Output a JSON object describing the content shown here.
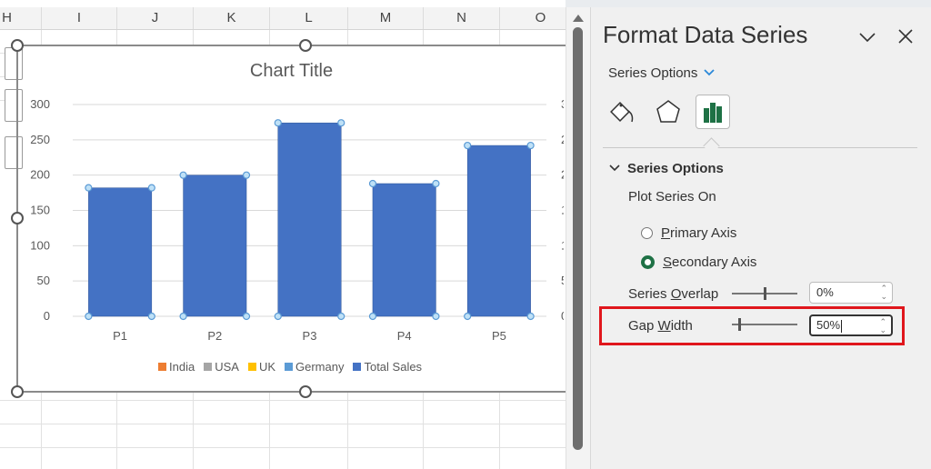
{
  "sheet": {
    "columns": [
      "H",
      "I",
      "J",
      "K",
      "L",
      "M",
      "N",
      "O"
    ]
  },
  "chart": {
    "title": "Chart Title"
  },
  "chart_data": {
    "type": "bar",
    "title": "Chart Title",
    "categories": [
      "P1",
      "P2",
      "P3",
      "P4",
      "P5"
    ],
    "series": [
      {
        "name": "Total Sales",
        "values": [
          182,
          200,
          274,
          188,
          242
        ],
        "color": "#4472c4",
        "axis": "secondary",
        "selected": true
      }
    ],
    "legend": [
      {
        "name": "India",
        "color": "#ed7d31"
      },
      {
        "name": "USA",
        "color": "#a5a5a5"
      },
      {
        "name": "UK",
        "color": "#ffc000"
      },
      {
        "name": "Germany",
        "color": "#5b9bd5"
      },
      {
        "name": "Total Sales",
        "color": "#4472c4"
      }
    ],
    "legend_position": "bottom",
    "y_ticks": [
      "0",
      "50",
      "100",
      "150",
      "200",
      "250",
      "300"
    ],
    "ylim": [
      0,
      300
    ],
    "grid": true,
    "xlabel": "",
    "ylabel": "",
    "secondary_axis_labels_clipped": true
  },
  "pane": {
    "title": "Format Data Series",
    "dropdown_label": "Series Options",
    "tabs": [
      "Fill & Line",
      "Effects",
      "Series Options"
    ],
    "active_tab": "Series Options",
    "section_title": "Series Options",
    "plot_series_on_label": "Plot Series On",
    "primary_axis": {
      "pre": "",
      "u": "P",
      "post": "rimary Axis",
      "selected": false
    },
    "secondary_axis": {
      "pre": "",
      "u": "S",
      "post": "econdary Axis",
      "selected": true
    },
    "series_overlap": {
      "pre": "Series ",
      "u": "O",
      "post": "verlap",
      "value": "0%",
      "percent": 0
    },
    "gap_width": {
      "pre": "Gap ",
      "u": "W",
      "post": "idth",
      "value": "50%",
      "percent": 50
    },
    "accent_color": "#1e7145",
    "highlight_color": "#e0161c"
  }
}
